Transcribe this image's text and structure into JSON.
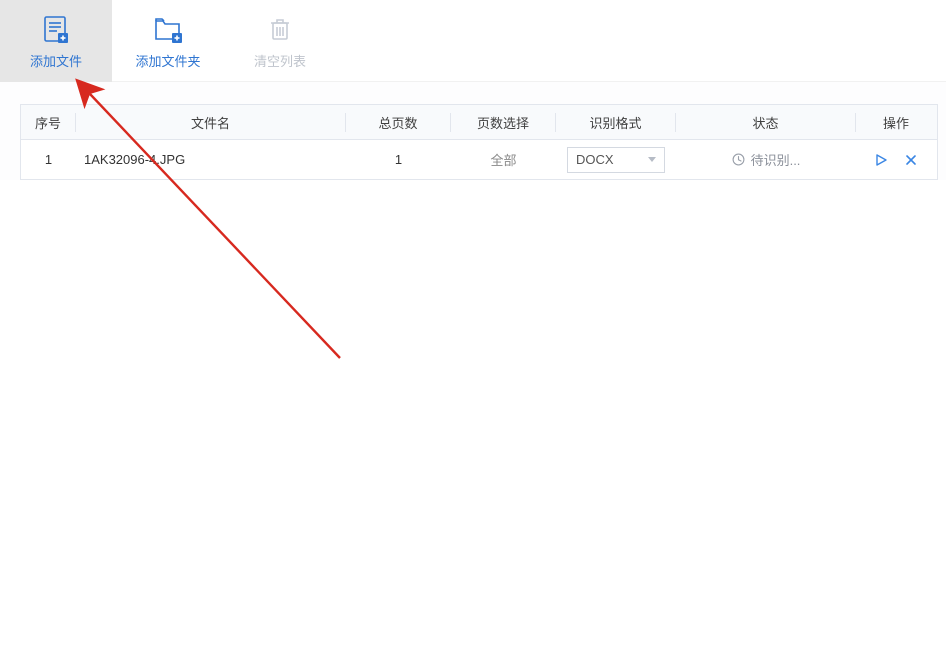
{
  "toolbar": {
    "addFile": {
      "label": "添加文件",
      "icon": "add-file-icon"
    },
    "addFolder": {
      "label": "添加文件夹",
      "icon": "add-folder-icon"
    },
    "clearList": {
      "label": "清空列表",
      "icon": "trash-icon"
    }
  },
  "table": {
    "headers": {
      "seq": "序号",
      "name": "文件名",
      "pages": "总页数",
      "range": "页数选择",
      "fmt": "识别格式",
      "stat": "状态",
      "ops": "操作"
    },
    "rows": [
      {
        "seq": "1",
        "name": "1AK32096-4.JPG",
        "pages": "1",
        "range": "全部",
        "fmt": "DOCX",
        "stat": "待识别..."
      }
    ]
  },
  "colors": {
    "accent": "#2f75d1",
    "muted": "#8a8f99",
    "border": "#e2e6ed",
    "annotationRed": "#d7291f"
  }
}
